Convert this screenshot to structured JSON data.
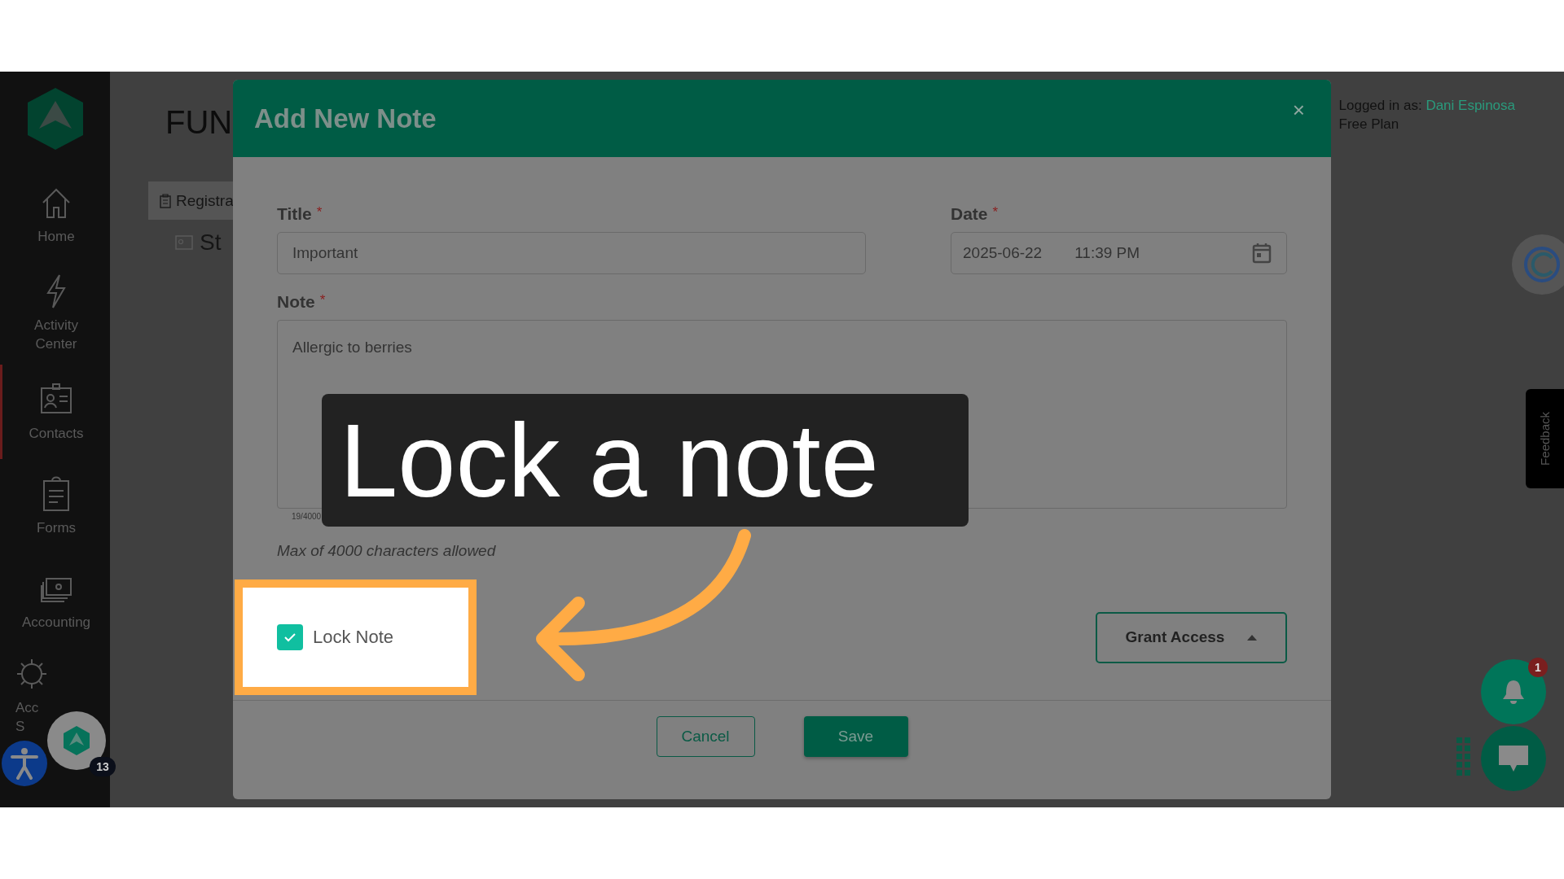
{
  "sidebar": {
    "items": [
      {
        "lines": [
          "Home"
        ],
        "selected": false,
        "kind": "full"
      },
      {
        "lines": [
          "Activity",
          "Center"
        ],
        "selected": false,
        "kind": "full"
      },
      {
        "lines": [
          "Contacts"
        ],
        "selected": true,
        "kind": "full"
      },
      {
        "lines": [
          "Forms"
        ],
        "selected": false,
        "kind": "full"
      },
      {
        "lines": [
          "Accounting"
        ],
        "selected": false,
        "kind": "full"
      },
      {
        "lines": [
          "Acc",
          "S"
        ],
        "selected": false,
        "kind": "clipped"
      }
    ]
  },
  "page": {
    "heading": "FUN",
    "tabs": [
      {
        "label": "Registra",
        "selected": true
      }
    ],
    "section": "St",
    "user": {
      "prefix": "Logged in as:",
      "name": "Dani Espinosa",
      "plan": "Free Plan"
    }
  },
  "dialog": {
    "title": "Add New Note",
    "close": "×",
    "title_field": {
      "label": "Title",
      "required": "*",
      "value": "Important"
    },
    "date_field": {
      "label": "Date",
      "required": "*",
      "date": "2025-06-22",
      "time": "11:39 PM"
    },
    "note_field": {
      "label": "Note",
      "required": "*",
      "value": "Allergic to berries",
      "counter": "19/4000"
    },
    "hint": "Max of 4000 characters allowed",
    "lock": {
      "label": "Lock Note",
      "checked": true
    },
    "grant_access": "Grant Access",
    "buttons": [
      {
        "label": "Cancel",
        "kind": "secondary"
      },
      {
        "label": "Save",
        "kind": "primary"
      }
    ]
  },
  "annotation": {
    "callout": "Lock a note"
  },
  "widgets": {
    "feedback": "Feedback",
    "notification_count": "1",
    "avatar_count": "13"
  }
}
